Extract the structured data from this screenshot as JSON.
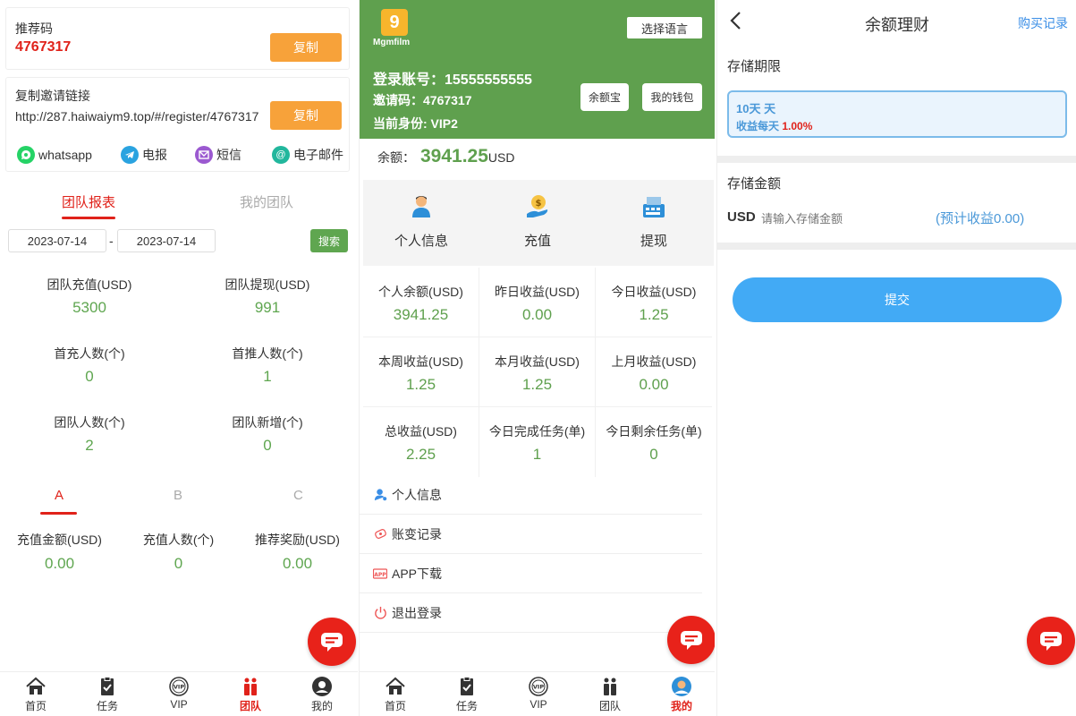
{
  "panel_team": {
    "referral": {
      "label": "推荐码",
      "code": "4767317",
      "copy_label": "复制"
    },
    "invite_link": {
      "label": "复制邀请链接",
      "url": "http://287.haiwaiym9.top/#/register/4767317",
      "copy_label": "复制"
    },
    "share": [
      {
        "label": "whatsapp",
        "icon": "whatsapp-icon",
        "color": "#25d366"
      },
      {
        "label": "电报",
        "icon": "telegram-icon",
        "color": "#2aa3e0"
      },
      {
        "label": "短信",
        "icon": "sms-icon",
        "color": "#9b59d0"
      },
      {
        "label": "电子邮件",
        "icon": "email-icon",
        "color": "#22b79d"
      }
    ],
    "tabs": [
      {
        "label": "团队报表",
        "active": true
      },
      {
        "label": "我的团队",
        "active": false
      }
    ],
    "date_from": "2023-07-14",
    "date_sep": "-",
    "date_to": "2023-07-14",
    "search_label": "搜索",
    "stats": [
      {
        "label": "团队充值(USD)",
        "value": "5300"
      },
      {
        "label": "团队提现(USD)",
        "value": "991"
      },
      {
        "label": "首充人数(个)",
        "value": "0"
      },
      {
        "label": "首推人数(个)",
        "value": "1"
      },
      {
        "label": "团队人数(个)",
        "value": "2"
      },
      {
        "label": "团队新增(个)",
        "value": "0"
      }
    ],
    "levels": [
      {
        "label": "A",
        "active": true
      },
      {
        "label": "B",
        "active": false
      },
      {
        "label": "C",
        "active": false
      }
    ],
    "level_stats": [
      {
        "label": "充值金额(USD)",
        "value": "0.00"
      },
      {
        "label": "充值人数(个)",
        "value": "0"
      },
      {
        "label": "推荐奖励(USD)",
        "value": "0.00"
      }
    ],
    "tabbar": [
      {
        "label": "首页",
        "icon": "home-icon"
      },
      {
        "label": "任务",
        "icon": "task-icon"
      },
      {
        "label": "VIP",
        "icon": "vip-icon"
      },
      {
        "label": "团队",
        "icon": "team-icon",
        "active": true
      },
      {
        "label": "我的",
        "icon": "profile-icon"
      }
    ]
  },
  "panel_mine": {
    "logo_text": "Mgmfilm",
    "lang_label": "选择语言",
    "account": "登录账号：15555555555",
    "invite_code": "邀请码：4767317",
    "identity": "当前身份: VIP2",
    "btn_yuebao": "余额宝",
    "btn_wallet": "我的钱包",
    "balance_label": "余额：",
    "balance_value": "3941.25",
    "balance_unit": "USD",
    "actions": [
      {
        "label": "个人信息",
        "icon": "person-icon"
      },
      {
        "label": "充值",
        "icon": "recharge-icon"
      },
      {
        "label": "提现",
        "icon": "withdraw-icon"
      }
    ],
    "grid": [
      {
        "label": "个人余额(USD)",
        "value": "3941.25"
      },
      {
        "label": "昨日收益(USD)",
        "value": "0.00"
      },
      {
        "label": "今日收益(USD)",
        "value": "1.25"
      },
      {
        "label": "本周收益(USD)",
        "value": "1.25"
      },
      {
        "label": "本月收益(USD)",
        "value": "1.25"
      },
      {
        "label": "上月收益(USD)",
        "value": "0.00"
      },
      {
        "label": "总收益(USD)",
        "value": "2.25"
      },
      {
        "label": "今日完成任务(单)",
        "value": "1"
      },
      {
        "label": "今日剩余任务(单)",
        "value": "0"
      }
    ],
    "menu": [
      {
        "label": "个人信息",
        "icon": "user-icon"
      },
      {
        "label": "账变记录",
        "icon": "record-icon"
      },
      {
        "label": "APP下载",
        "icon": "app-icon"
      },
      {
        "label": "退出登录",
        "icon": "power-icon"
      }
    ],
    "tabbar": [
      {
        "label": "首页",
        "icon": "home-icon"
      },
      {
        "label": "任务",
        "icon": "task-icon"
      },
      {
        "label": "VIP",
        "icon": "vip-icon"
      },
      {
        "label": "团队",
        "icon": "team-icon"
      },
      {
        "label": "我的",
        "icon": "profile-icon",
        "active": true
      }
    ]
  },
  "panel_finance": {
    "title": "余额理财",
    "buy_records": "购买记录",
    "period_label": "存储期限",
    "period_option": "10天 天",
    "rate_prefix": "收益每天 ",
    "rate_value": "1.00%",
    "amount_label": "存储金额",
    "currency": "USD",
    "amount_placeholder": "请输入存储金额",
    "estimate": "(预计收益0.00)",
    "submit_label": "提交"
  },
  "colors": {
    "accent_red": "#e0221a",
    "green": "#5fa04e",
    "orange": "#f7a23a",
    "blue": "#42aaf5"
  }
}
